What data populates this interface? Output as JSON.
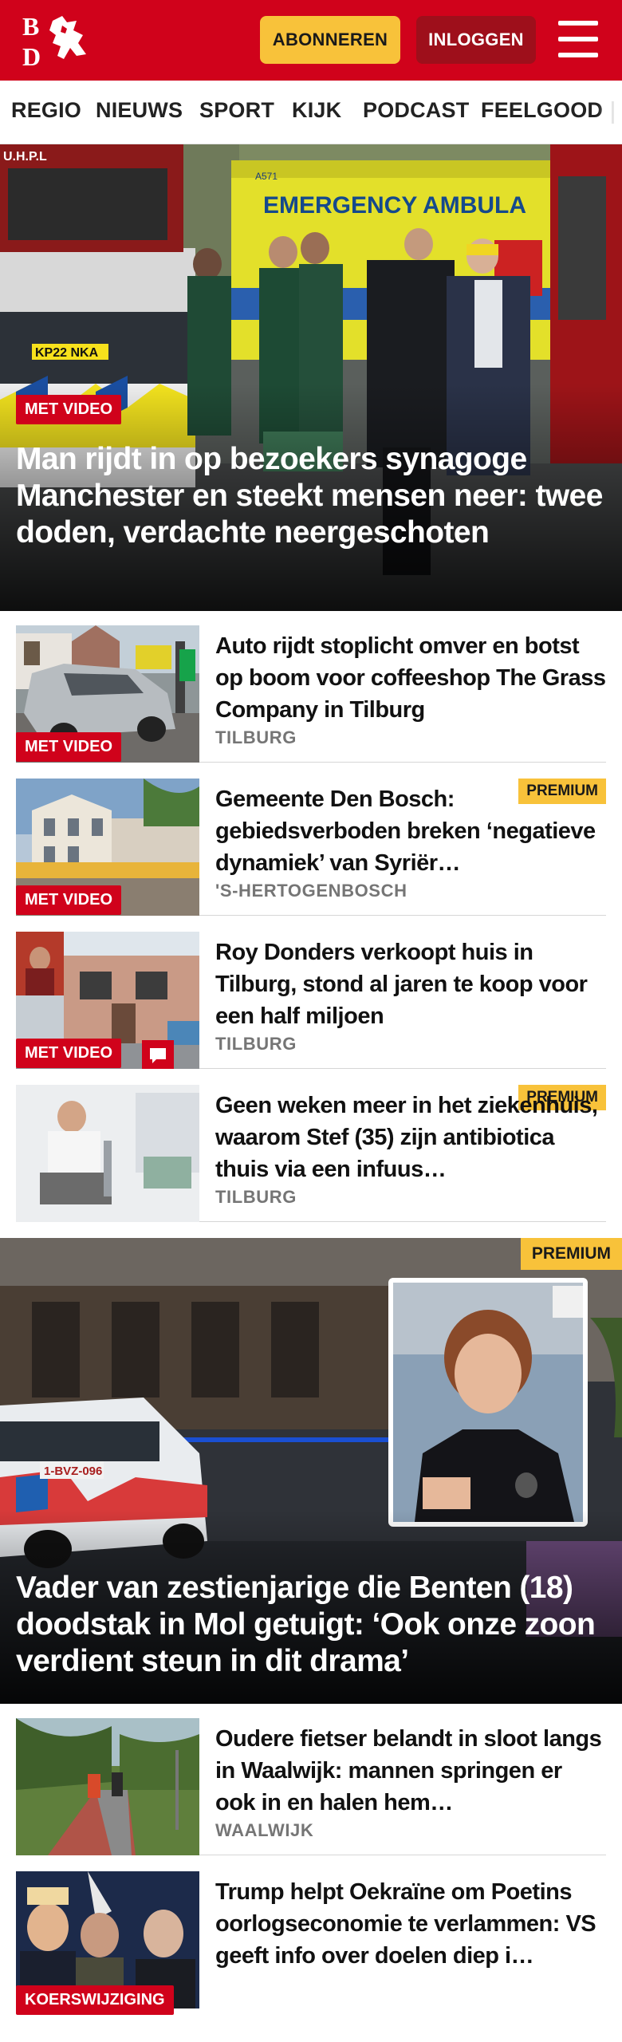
{
  "header": {
    "logo_text": "BD",
    "subscribe_label": "ABONNEREN",
    "login_label": "INLOGGEN",
    "brand_color": "#d0021b",
    "accent_color": "#f8c23a"
  },
  "nav": {
    "items": [
      "REGIO",
      "NIEUWS",
      "SPORT",
      "KIJK",
      "PODCAST",
      "FEELGOOD"
    ]
  },
  "hero": {
    "badge": "MET VIDEO",
    "title": "Man rijdt in op bezoekers synagoge Manchester en steekt mensen neer: twee doden, verdachte neergescho­ten",
    "image_text": {
      "ambulance": "EMERGENCY AMBULA",
      "plate": "KP22 NKA",
      "sign": "U.H.P.L",
      "ambulance_code": "A571"
    }
  },
  "articles": [
    {
      "title": "Auto rijdt stoplicht omver en botst op boom voor coffeeshop The Grass Company in Tilburg",
      "location": "TILBURG",
      "badge_video": "MET VIDEO"
    },
    {
      "title": "Gemeente Den Bosch: gebiedsverboden breken ‘negatieve dynamiek’ van Syriër…",
      "location": "'S-HERTOGENBOSCH",
      "badge_video": "MET VIDEO",
      "badge_premium": "PREMIUM"
    },
    {
      "title": "Roy Donders verkoopt huis in Tilburg, stond al jaren te koop voor een half miljoen",
      "location": "TILBURG",
      "badge_video": "MET VIDEO"
    },
    {
      "title": "Geen weken meer in het ziekenhuis, waarom Stef (35) zijn antibiotica thuis via een infuus…",
      "location": "TILBURG",
      "badge_premium": "PREMIUM"
    }
  ],
  "feature": {
    "badge_premium": "PREMIUM",
    "title": "Vader van zestienjarige die Benten (18) doodstak in Mol getuigt: ‘Ook onze zoon verdient steun in dit drama’",
    "image_text": {
      "plate": "1-BVZ-096"
    }
  },
  "articles2": [
    {
      "title": "Oudere fietser belandt in sloot langs in Waalwijk: mannen springen er ook in en halen hem…",
      "location": "WAALWIJK"
    },
    {
      "title": "Trump helpt Oekraïne om Poetins oorlogseconomie te verlammen: VS geeft info over doelen diep i…",
      "badge_label": "KOERSWIJZIGING"
    }
  ]
}
